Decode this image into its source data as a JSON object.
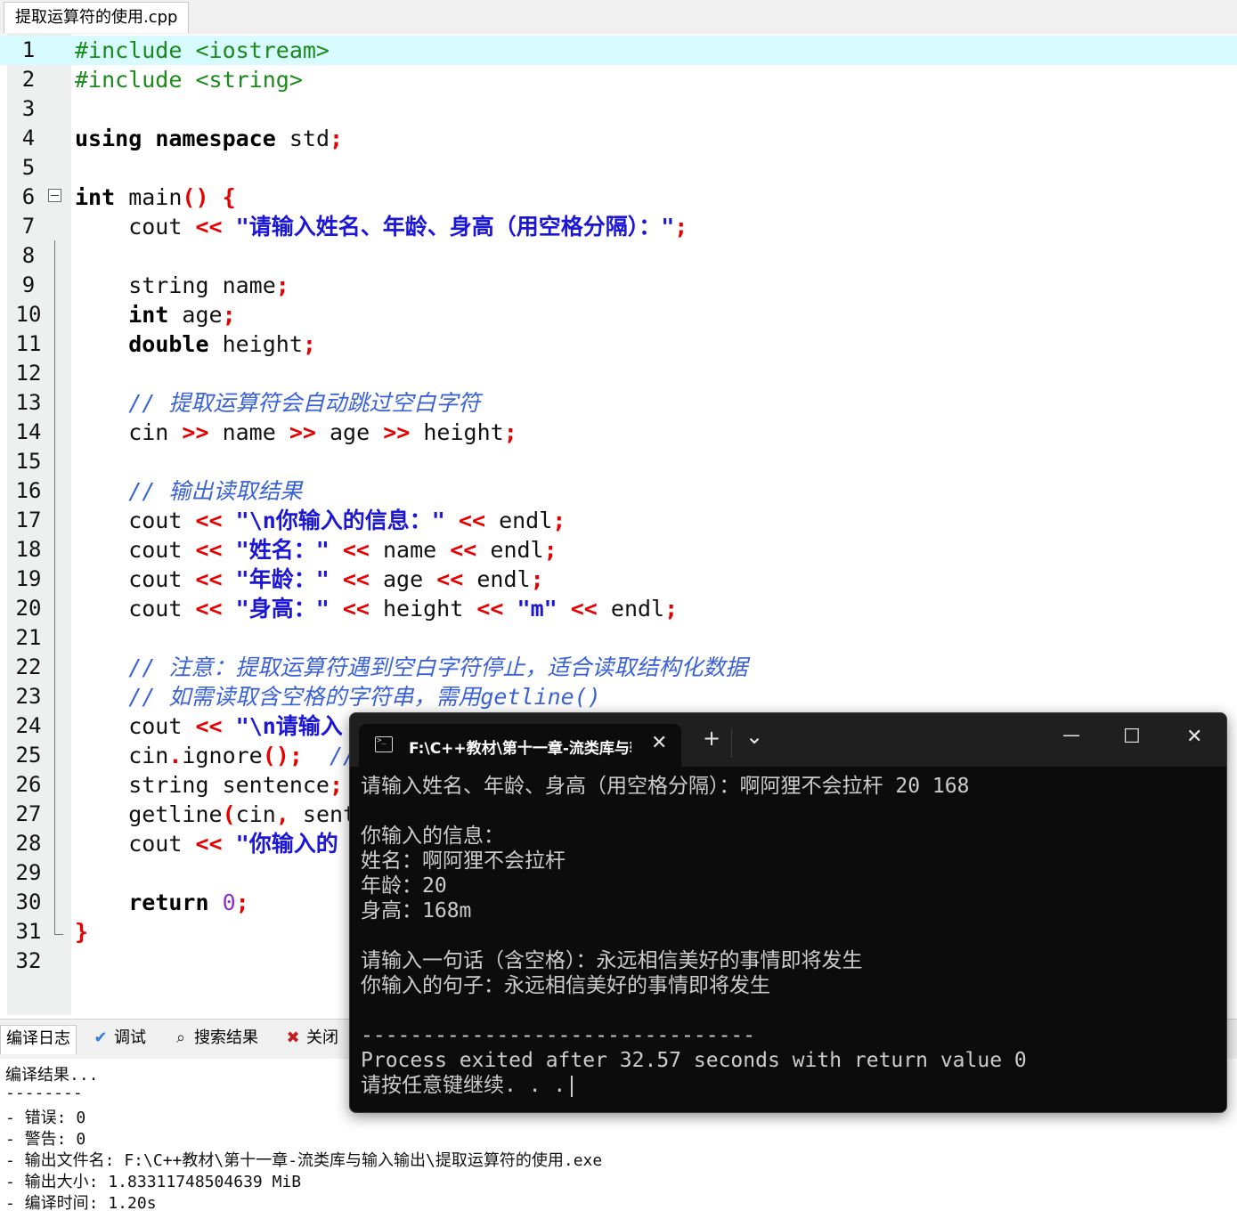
{
  "editor": {
    "tab_title": "提取运算符的使用.cpp",
    "lines": [
      {
        "n": "1",
        "parts": [
          {
            "t": "#include <iostream>",
            "c": "pp"
          }
        ],
        "current": true
      },
      {
        "n": "2",
        "parts": [
          {
            "t": "#include <string>",
            "c": "pp"
          }
        ]
      },
      {
        "n": "3",
        "parts": []
      },
      {
        "n": "4",
        "parts": [
          {
            "t": "using",
            "c": "kw"
          },
          {
            "t": " "
          },
          {
            "t": "namespace",
            "c": "kw"
          },
          {
            "t": " std"
          },
          {
            "t": ";",
            "c": "sym"
          }
        ]
      },
      {
        "n": "5",
        "parts": []
      },
      {
        "n": "6",
        "parts": [
          {
            "t": "int",
            "c": "kw"
          },
          {
            "t": " main"
          },
          {
            "t": "() {",
            "c": "sym"
          }
        ],
        "fold": true
      },
      {
        "n": "7",
        "parts": [
          {
            "t": "    cout "
          },
          {
            "t": "<<",
            "c": "sym"
          },
          {
            "t": " "
          },
          {
            "t": "\"请输入姓名、年龄、身高（用空格分隔）：\"",
            "c": "str"
          },
          {
            "t": ";",
            "c": "sym"
          }
        ]
      },
      {
        "n": "8",
        "parts": []
      },
      {
        "n": "9",
        "parts": [
          {
            "t": "    string name"
          },
          {
            "t": ";",
            "c": "sym"
          }
        ]
      },
      {
        "n": "10",
        "parts": [
          {
            "t": "    "
          },
          {
            "t": "int",
            "c": "kw"
          },
          {
            "t": " age"
          },
          {
            "t": ";",
            "c": "sym"
          }
        ]
      },
      {
        "n": "11",
        "parts": [
          {
            "t": "    "
          },
          {
            "t": "double",
            "c": "kw"
          },
          {
            "t": " height"
          },
          {
            "t": ";",
            "c": "sym"
          }
        ]
      },
      {
        "n": "12",
        "parts": []
      },
      {
        "n": "13",
        "parts": [
          {
            "t": "    // 提取运算符会自动跳过空白字符",
            "c": "cm"
          }
        ]
      },
      {
        "n": "14",
        "parts": [
          {
            "t": "    cin "
          },
          {
            "t": ">>",
            "c": "sym"
          },
          {
            "t": " name "
          },
          {
            "t": ">>",
            "c": "sym"
          },
          {
            "t": " age "
          },
          {
            "t": ">>",
            "c": "sym"
          },
          {
            "t": " height"
          },
          {
            "t": ";",
            "c": "sym"
          }
        ]
      },
      {
        "n": "15",
        "parts": []
      },
      {
        "n": "16",
        "parts": [
          {
            "t": "    // 输出读取结果",
            "c": "cm"
          }
        ]
      },
      {
        "n": "17",
        "parts": [
          {
            "t": "    cout "
          },
          {
            "t": "<<",
            "c": "sym"
          },
          {
            "t": " "
          },
          {
            "t": "\"\\n你输入的信息：\"",
            "c": "str"
          },
          {
            "t": " "
          },
          {
            "t": "<<",
            "c": "sym"
          },
          {
            "t": " endl"
          },
          {
            "t": ";",
            "c": "sym"
          }
        ]
      },
      {
        "n": "18",
        "parts": [
          {
            "t": "    cout "
          },
          {
            "t": "<<",
            "c": "sym"
          },
          {
            "t": " "
          },
          {
            "t": "\"姓名：\"",
            "c": "str"
          },
          {
            "t": " "
          },
          {
            "t": "<<",
            "c": "sym"
          },
          {
            "t": " name "
          },
          {
            "t": "<<",
            "c": "sym"
          },
          {
            "t": " endl"
          },
          {
            "t": ";",
            "c": "sym"
          }
        ]
      },
      {
        "n": "19",
        "parts": [
          {
            "t": "    cout "
          },
          {
            "t": "<<",
            "c": "sym"
          },
          {
            "t": " "
          },
          {
            "t": "\"年龄：\"",
            "c": "str"
          },
          {
            "t": " "
          },
          {
            "t": "<<",
            "c": "sym"
          },
          {
            "t": " age "
          },
          {
            "t": "<<",
            "c": "sym"
          },
          {
            "t": " endl"
          },
          {
            "t": ";",
            "c": "sym"
          }
        ]
      },
      {
        "n": "20",
        "parts": [
          {
            "t": "    cout "
          },
          {
            "t": "<<",
            "c": "sym"
          },
          {
            "t": " "
          },
          {
            "t": "\"身高：\"",
            "c": "str"
          },
          {
            "t": " "
          },
          {
            "t": "<<",
            "c": "sym"
          },
          {
            "t": " height "
          },
          {
            "t": "<<",
            "c": "sym"
          },
          {
            "t": " "
          },
          {
            "t": "\"m\"",
            "c": "str"
          },
          {
            "t": " "
          },
          {
            "t": "<<",
            "c": "sym"
          },
          {
            "t": " endl"
          },
          {
            "t": ";",
            "c": "sym"
          }
        ]
      },
      {
        "n": "21",
        "parts": []
      },
      {
        "n": "22",
        "parts": [
          {
            "t": "    // 注意：提取运算符遇到空白字符停止，适合读取结构化数据",
            "c": "cm"
          }
        ]
      },
      {
        "n": "23",
        "parts": [
          {
            "t": "    // 如需读取含空格的字符串，需用getline()",
            "c": "cm"
          }
        ]
      },
      {
        "n": "24",
        "parts": [
          {
            "t": "    cout "
          },
          {
            "t": "<<",
            "c": "sym"
          },
          {
            "t": " "
          },
          {
            "t": "\"\\n请输入",
            "c": "str"
          }
        ]
      },
      {
        "n": "25",
        "parts": [
          {
            "t": "    cin"
          },
          {
            "t": ".",
            "c": "sym"
          },
          {
            "t": "ignore"
          },
          {
            "t": "();",
            "c": "sym"
          },
          {
            "t": "  "
          },
          {
            "t": "//",
            "c": "cm"
          }
        ]
      },
      {
        "n": "26",
        "parts": [
          {
            "t": "    string sentence"
          },
          {
            "t": ";",
            "c": "sym"
          }
        ]
      },
      {
        "n": "27",
        "parts": [
          {
            "t": "    getline"
          },
          {
            "t": "(",
            "c": "sym"
          },
          {
            "t": "cin"
          },
          {
            "t": ",",
            "c": "sym"
          },
          {
            "t": " sent"
          }
        ]
      },
      {
        "n": "28",
        "parts": [
          {
            "t": "    cout "
          },
          {
            "t": "<<",
            "c": "sym"
          },
          {
            "t": " "
          },
          {
            "t": "\"你输入的",
            "c": "str"
          }
        ]
      },
      {
        "n": "29",
        "parts": []
      },
      {
        "n": "30",
        "parts": [
          {
            "t": "    "
          },
          {
            "t": "return",
            "c": "kw"
          },
          {
            "t": " "
          },
          {
            "t": "0",
            "c": "num"
          },
          {
            "t": ";",
            "c": "sym"
          }
        ]
      },
      {
        "n": "31",
        "parts": [
          {
            "t": "}",
            "c": "sym"
          }
        ]
      },
      {
        "n": "32",
        "parts": []
      }
    ]
  },
  "bottom_panel": {
    "tabs": [
      {
        "label": "编译日志",
        "icon": "compile-log-icon",
        "glyph": ""
      },
      {
        "label": "调试",
        "icon": "debug-check-icon",
        "glyph": "✔"
      },
      {
        "label": "搜索结果",
        "icon": "search-results-icon",
        "glyph": "⌕"
      },
      {
        "label": "关闭",
        "icon": "close-panel-icon",
        "glyph": "✖"
      }
    ],
    "log_lines": [
      "编译结果...",
      "--------",
      "- 错误: 0",
      "- 警告: 0",
      "- 输出文件名: F:\\C++教材\\第十一章-流类库与输入输出\\提取运算符的使用.exe",
      "- 输出大小: 1.83311748504639 MiB",
      "- 编译时间: 1.20s"
    ]
  },
  "terminal": {
    "tab_title": "F:\\C++教材\\第十一章-流类库与输入输出\\提取运算符的使用.exe",
    "new_tab": "+",
    "dropdown": "⌄",
    "minimize": "—",
    "maximize": "☐",
    "close": "✕",
    "tab_close": "✕",
    "lines": [
      "请输入姓名、年龄、身高（用空格分隔）：啊阿狸不会拉杆 20 168",
      "",
      "你输入的信息：",
      "姓名：啊阿狸不会拉杆",
      "年龄：20",
      "身高：168m",
      "",
      "请输入一句话（含空格）：永远相信美好的事情即将发生",
      "你输入的句子：永远相信美好的事情即将发生",
      "",
      "--------------------------------",
      "Process exited after 32.57 seconds with return value 0",
      "请按任意键继续. . ."
    ]
  }
}
